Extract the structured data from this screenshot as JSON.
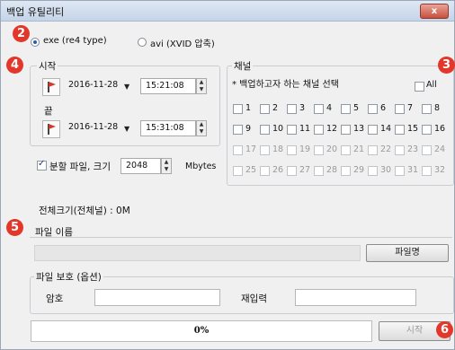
{
  "window": {
    "title": "백업 유틸리티",
    "close_label": "x"
  },
  "format": {
    "option_exe": "exe (re4 type)",
    "option_avi": "avi (XVID 압축)",
    "selected": "exe"
  },
  "time": {
    "start_label": "시작",
    "start_date": "2016-11-28",
    "start_time": "15:21:08",
    "end_label": "끝",
    "end_date": "2016-11-28",
    "end_time": "15:31:08"
  },
  "split": {
    "label": "분할 파일, 크기",
    "size": "2048",
    "unit": "Mbytes",
    "checked": true
  },
  "channel": {
    "title": "채널",
    "hint": "* 백업하고자 하는 채널 선택",
    "all_label": "All",
    "channels": [
      "1",
      "2",
      "3",
      "4",
      "5",
      "6",
      "7",
      "8",
      "9",
      "10",
      "11",
      "12",
      "13",
      "14",
      "15",
      "16",
      "17",
      "18",
      "19",
      "20",
      "21",
      "22",
      "23",
      "24",
      "25",
      "26",
      "27",
      "28",
      "29",
      "30",
      "31",
      "32"
    ],
    "enabled_count": 16
  },
  "total_size": "전체크기(전체널) : 0M",
  "file": {
    "title": "파일 이름",
    "value": "",
    "button": "파일명"
  },
  "protect": {
    "title": "파일 보호 (옵션)",
    "password_label": "암호",
    "confirm_label": "재입력"
  },
  "progress": {
    "text": "0%",
    "value": 0
  },
  "start_button": "시작",
  "badges": [
    "2",
    "3",
    "4",
    "5",
    "6"
  ],
  "colors": {
    "badge": "#e2372a",
    "accent": "#2a5db0"
  }
}
